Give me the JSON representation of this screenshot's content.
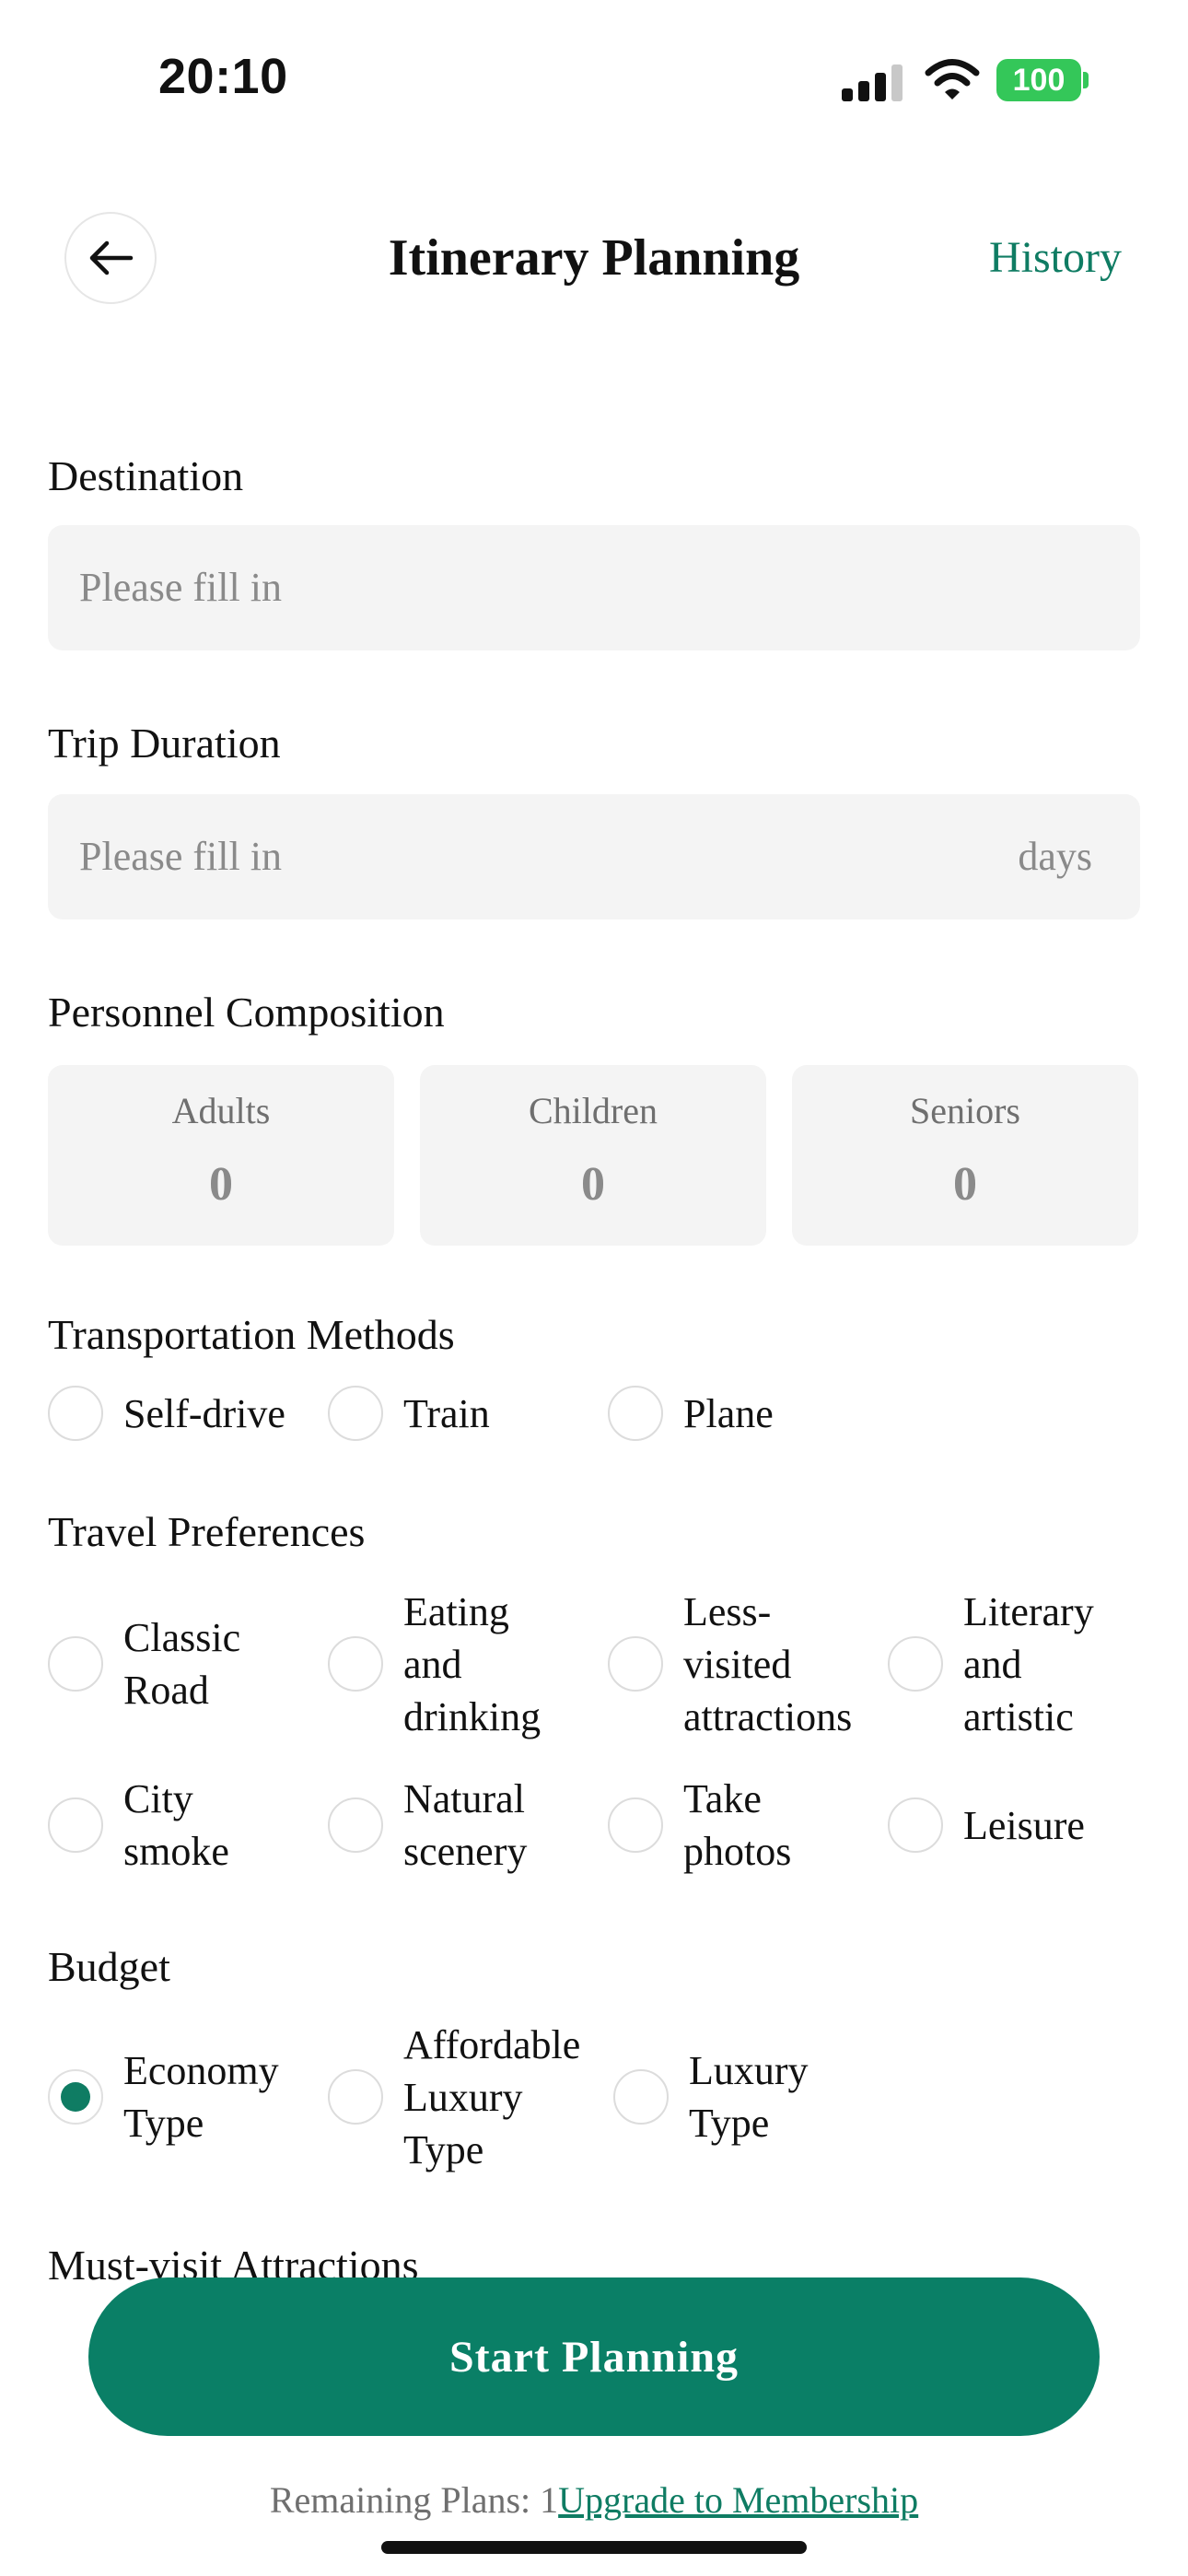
{
  "status_bar": {
    "time": "20:10",
    "battery": "100",
    "icons": [
      "cellular-signal-icon",
      "wifi-icon",
      "battery-icon"
    ]
  },
  "header": {
    "back_icon": "arrow-left-icon",
    "title": "Itinerary Planning",
    "history": "History"
  },
  "destination": {
    "label": "Destination",
    "placeholder": "Please fill in"
  },
  "duration": {
    "label": "Trip Duration",
    "placeholder": "Please fill in",
    "suffix": "days"
  },
  "personnel": {
    "label": "Personnel Composition",
    "items": [
      {
        "label": "Adults",
        "value": "0"
      },
      {
        "label": "Children",
        "value": "0"
      },
      {
        "label": "Seniors",
        "value": "0"
      }
    ]
  },
  "transport": {
    "label": "Transportation Methods",
    "options": [
      "Self-drive",
      "Train",
      "Plane"
    ]
  },
  "preferences": {
    "label": "Travel Preferences",
    "options": [
      [
        "Classic",
        "Road"
      ],
      [
        "Eating",
        "and",
        "drinking"
      ],
      [
        "Less-",
        "visited",
        "attractions"
      ],
      [
        "Literary",
        "and",
        "artistic"
      ],
      [
        "City",
        "smoke"
      ],
      [
        "Natural",
        "scenery"
      ],
      [
        "Take",
        "photos"
      ],
      [
        "Leisure"
      ]
    ]
  },
  "budget": {
    "label": "Budget",
    "options": [
      [
        "Economy",
        "Type"
      ],
      [
        "Affordable",
        "Luxury",
        "Type"
      ],
      [
        "Luxury",
        "Type"
      ]
    ],
    "selected": [
      "Economy",
      "Type"
    ]
  },
  "attractions": {
    "label": "Must-visit Attractions"
  },
  "actions": {
    "start": "Start Planning",
    "remaining_prefix": "Remaining Plans: 1",
    "upgrade": "Upgrade to Membership"
  },
  "colors": {
    "accent": "#0a7f66",
    "field_bg": "#f4f4f4",
    "battery": "#34c759"
  }
}
